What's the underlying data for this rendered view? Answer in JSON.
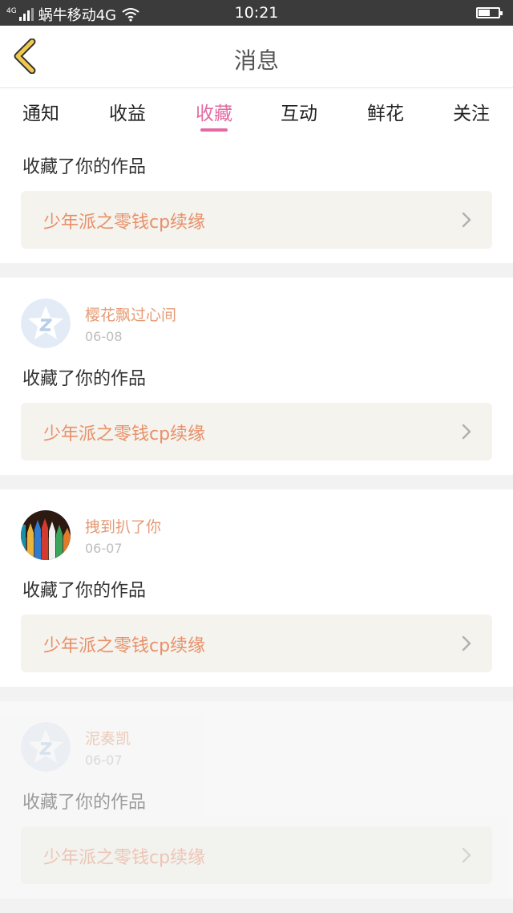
{
  "status_bar": {
    "network_tag": "4G",
    "carrier": "蜗牛移动4G",
    "time": "10:21",
    "battery_level": 0.6,
    "icons": [
      "signal-icon",
      "wifi-icon",
      "battery-icon"
    ]
  },
  "header": {
    "title": "消息",
    "back_icon": "chevron-left-icon",
    "accent_color": "#f2c94c"
  },
  "tabs": {
    "items": [
      "通知",
      "收益",
      "收藏",
      "互动",
      "鲜花",
      "关注"
    ],
    "active": "收藏",
    "active_color": "#e26aa0"
  },
  "messages": [
    {
      "action": "收藏了你的作品",
      "work_title": "少年派之零钱cp续缘"
    },
    {
      "username": "樱花飘过心间",
      "date": "06-08",
      "avatar": "default-avatar-icon",
      "action": "收藏了你的作品",
      "work_title": "少年派之零钱cp续缘"
    },
    {
      "username": "拽到扒了你",
      "date": "06-07",
      "avatar": "pencils-avatar",
      "action": "收藏了你的作品",
      "work_title": "少年派之零钱cp续缘"
    },
    {
      "username": "泥奏凯",
      "date": "06-07",
      "avatar": "default-avatar-icon",
      "action": "收藏了你的作品",
      "work_title": "少年派之零钱cp续缘"
    }
  ]
}
